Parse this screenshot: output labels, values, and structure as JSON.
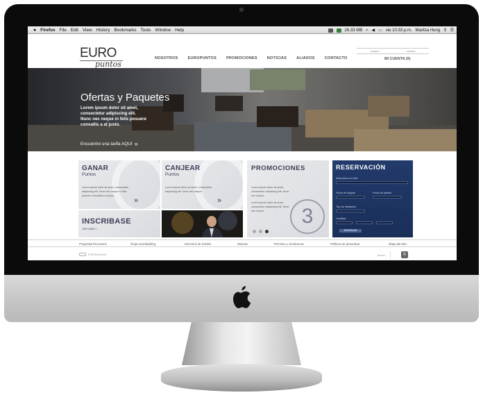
{
  "menubar": {
    "items": [
      "Firefox",
      "File",
      "Edit",
      "View",
      "History",
      "Bookmarks",
      "Tools",
      "Window",
      "Help"
    ],
    "status_memory": "26.33 MB",
    "clock": "vie 10:33 p.m.",
    "user": "Maritza Hung"
  },
  "site": {
    "logo_euro": "EURO",
    "logo_puntos": "puntos",
    "nav": [
      "NOSOTROS",
      "EUROPUNTOS",
      "PROMOCIONES",
      "NOTICIAS",
      "ALIADOS",
      "CONTACTO"
    ],
    "login_user": "usuario",
    "login_pass": "usuario",
    "account": "MI CUENTA (0)"
  },
  "hero": {
    "title": "Ofertas y Paquetes",
    "lines": [
      "Lorem ipsum dolor sit amet,",
      "consectetur adipiscing elit.",
      "Nunc nec neque in felis posuere",
      "convallis a at justo."
    ],
    "link": "Encuentre una tarifa AQUI",
    "arrows": "< >"
  },
  "tiles": {
    "ganar": {
      "title": "GANAR",
      "sub": "Puntos",
      "body": "Lorem ipsum dolor sit amet, consectetur adipiscing elit. Nunc nec neque in felis posuere convallis a at justo."
    },
    "canjear": {
      "title": "CANJEAR",
      "sub": "Puntos",
      "body": "Lorem ipsum dolor sit amet, consectetur adipiscing elit. Nunc nec neque."
    },
    "promociones": {
      "title": "PROMOCIONES",
      "body1": "Lorem ipsum dolor sit amet, consectetur adipiscing elit. Nunc nec neque.",
      "body2": "Lorem ipsum dolor sit amet, consectetur adipiscing elit. Nunc nec neque.",
      "number": "3"
    },
    "inscribase": {
      "title": "INSCRIBASE",
      "sub": "VER MÁS »"
    }
  },
  "reservation": {
    "title": "RESERVACIÓN",
    "hotel_label": "Seleccione un hotel",
    "checkin_label": "Fecha de llegada",
    "checkout_label": "Fecha de partida",
    "room_label": "Tipo de habitación",
    "qty_label": "Cantidad",
    "button": "RESERVAR"
  },
  "footer": {
    "links": [
      "Preguntas frecuentes",
      "Grupo Eurobuilding",
      "Directorio de hoteles",
      "Noticias",
      "Términos y condiciones",
      "Políticas de privacidad",
      "Mapa del sitio"
    ],
    "brand": "EUROBUILDING",
    "search": "Buscar"
  }
}
